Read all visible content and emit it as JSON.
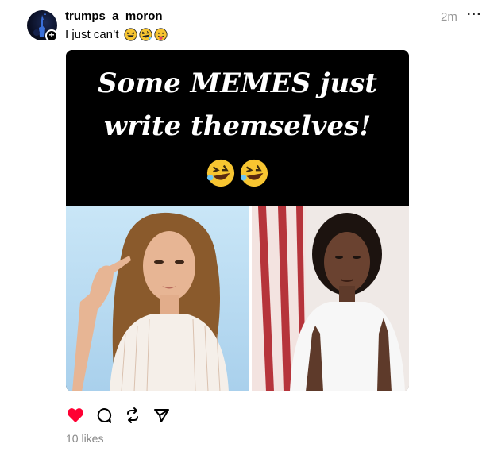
{
  "post": {
    "username": "trumps_a_moron",
    "caption": "I just can’t",
    "caption_emojis": [
      "grinning-squint-emoji",
      "rofl-emoji",
      "tongue-out-emoji"
    ],
    "timestamp": "2m",
    "more_label": "···",
    "likes": "10 likes",
    "liked": true
  },
  "meme": {
    "line1": "Some MEMES just",
    "line2": "write themselves!",
    "emojis": [
      "rofl-emoji",
      "rofl-emoji"
    ]
  },
  "colors": {
    "heart": "#ff0033",
    "muted": "#999999",
    "emoji": "#f7c531"
  },
  "icons": {
    "like": "heart-icon",
    "comment": "comment-icon",
    "repost": "repost-icon",
    "share": "send-icon"
  }
}
